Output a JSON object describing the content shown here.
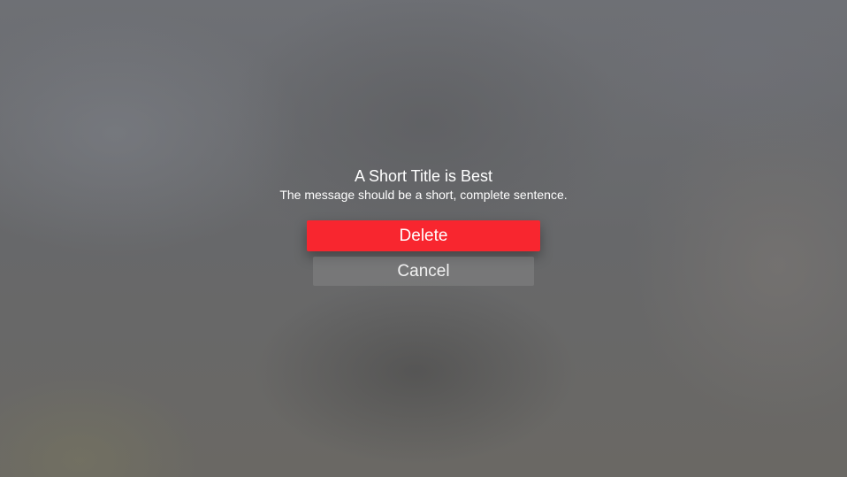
{
  "alert": {
    "title": "A Short Title is Best",
    "message": "The message should be a short, complete sentence."
  },
  "actions": {
    "delete_label": "Delete",
    "cancel_label": "Cancel"
  },
  "colors": {
    "destructive": "#f8262f",
    "cancel_background": "#7b7b7c",
    "text": "#ffffff"
  }
}
